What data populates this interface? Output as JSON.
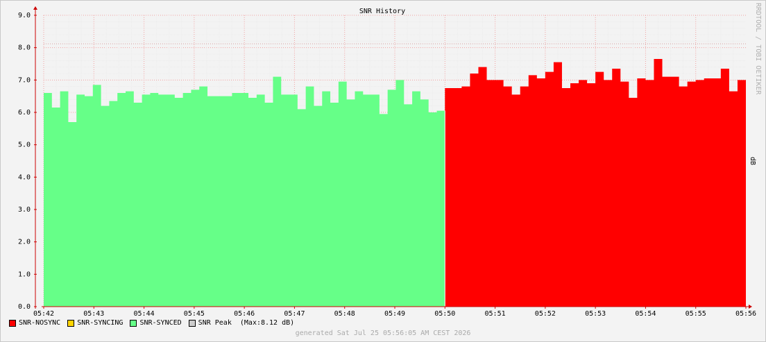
{
  "colors": {
    "background": "#f3f3f3",
    "grid_minor": "#ececec",
    "grid_major": "#f2a0a0",
    "axis": "#cc0000",
    "nosync": "#ff0000",
    "syncing": "#ffd400",
    "synced": "#66ff88",
    "peak": "#cccccc"
  },
  "chart_data": {
    "type": "area",
    "title": "SNR History",
    "ylabel": "dB",
    "watermark": "RRDTOOL / TOBI OETIKER",
    "ylim": [
      0,
      9
    ],
    "yticks": [
      "0.0",
      "1.0",
      "2.0",
      "3.0",
      "4.0",
      "5.0",
      "6.0",
      "7.0",
      "8.0",
      "9.0"
    ],
    "xticks": [
      "05:42",
      "05:43",
      "05:44",
      "05:45",
      "05:46",
      "05:47",
      "05:48",
      "05:49",
      "05:50",
      "05:51",
      "05:52",
      "05:53",
      "05:54",
      "05:55",
      "05:56"
    ],
    "peak_line": 8.12,
    "series": [
      {
        "name": "SNR-SYNCED",
        "start": "05:42",
        "end": "05:50",
        "values": [
          6.6,
          6.15,
          6.65,
          5.7,
          6.55,
          6.5,
          6.85,
          6.2,
          6.35,
          6.6,
          6.65,
          6.3,
          6.55,
          6.6,
          6.55,
          6.55,
          6.45,
          6.6,
          6.7,
          6.8,
          6.5,
          6.5,
          6.5,
          6.6,
          6.6,
          6.45,
          6.55,
          6.3,
          7.1,
          6.55,
          6.55,
          6.1,
          6.8,
          6.2,
          6.65,
          6.3,
          6.95,
          6.4,
          6.65,
          6.55,
          6.55,
          5.95,
          6.7,
          7.0,
          6.25,
          6.65,
          6.4,
          6.0,
          6.05
        ]
      },
      {
        "name": "SNR-NOSYNC",
        "start": "05:50",
        "end": "05:56",
        "values": [
          6.75,
          6.75,
          6.8,
          7.2,
          7.4,
          7.0,
          7.0,
          6.8,
          6.55,
          6.8,
          7.15,
          7.05,
          7.25,
          7.55,
          6.75,
          6.9,
          7.0,
          6.9,
          7.25,
          7.0,
          7.35,
          6.95,
          6.45,
          7.05,
          7.0,
          7.65,
          7.1,
          7.1,
          6.8,
          6.95,
          7.0,
          7.05,
          7.05,
          7.35,
          6.65,
          7.0
        ]
      }
    ]
  },
  "legend": [
    {
      "key": "nosync",
      "label": "SNR-NOSYNC"
    },
    {
      "key": "syncing",
      "label": "SNR-SYNCING"
    },
    {
      "key": "synced",
      "label": "SNR-SYNCED"
    },
    {
      "key": "peak",
      "label": "SNR Peak  (Max:8.12 dB)"
    }
  ],
  "footer": "generated Sat Jul 25 05:56:05 AM CEST 2026"
}
